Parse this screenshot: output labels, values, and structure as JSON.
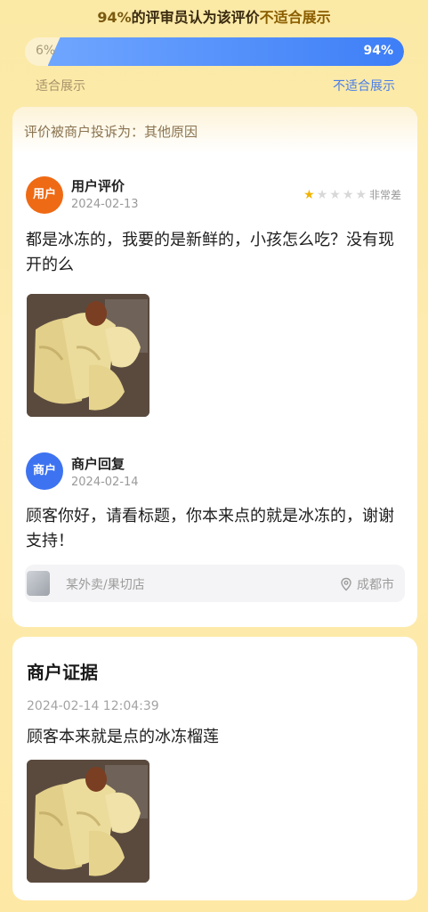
{
  "vote": {
    "pct_text": "94%",
    "title_mid": "的评审员认为该评价",
    "title_verdict": "不适合展示",
    "left_pct": "6%",
    "right_pct": "94%",
    "left_label": "适合展示",
    "right_label": "不适合展示",
    "unsuitable_fraction": 0.94
  },
  "complaint": {
    "header": "评价被商户投诉为：其他原因"
  },
  "user_review": {
    "avatar_text": "用户",
    "title": "用户评价",
    "date": "2024-02-13",
    "rating": 1,
    "rating_max": 5,
    "rating_text": "非常差",
    "text": "都是冰冻的，我要的是新鲜的，小孩怎么吃？没有现开的么",
    "photo_icon": "durian-photo"
  },
  "merchant_reply": {
    "avatar_text": "商户",
    "title": "商户回复",
    "date": "2024-02-14",
    "text": "顾客你好，请看标题，你本来点的就是冰冻的，谢谢支持！"
  },
  "shop": {
    "name": "某外卖/果切店",
    "city": "成都市",
    "icon": "location-pin-icon"
  },
  "evidence": {
    "title": "商户证据",
    "time": "2024-02-14 12:04:39",
    "text": "顾客本来就是点的冰冻榴莲",
    "photo_icon": "durian-photo"
  },
  "colors": {
    "user_avatar": "#ef6a14",
    "merchant_avatar": "#3d73f0",
    "bar_blue": "#3d7ef7",
    "star_on": "#f0b400"
  }
}
